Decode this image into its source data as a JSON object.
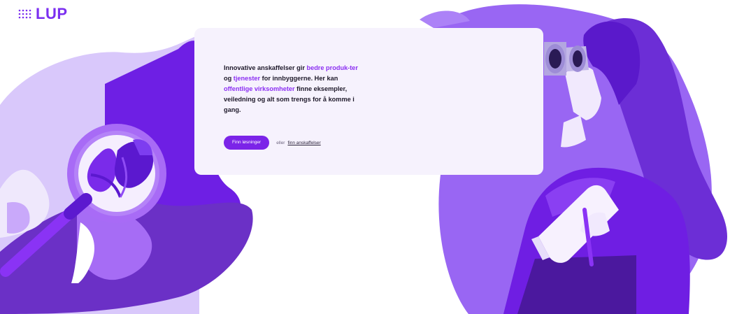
{
  "brand": {
    "logo_text": "LUP",
    "logo_icon": "dot-grid-icon",
    "accent": "#8b2ff2"
  },
  "intro": {
    "t1": "Innovative anskaffelser gir ",
    "h1": "bedre produk-ter",
    "t2": " og ",
    "h2": "tjenester",
    "t3": " for innbyggerne. Her kan ",
    "h3": "offentlige virksomheter",
    "t4": " finne eksempler, veiledning og alt som trengs for å komme i gang."
  },
  "cta": {
    "button_label": "Finn løsninger",
    "or_text": "eller",
    "link_label": "finn anskaffelser"
  },
  "illustrations": {
    "left": "magnifying-glass-with-leaves",
    "right": "woman-with-binoculars-and-notepad"
  }
}
